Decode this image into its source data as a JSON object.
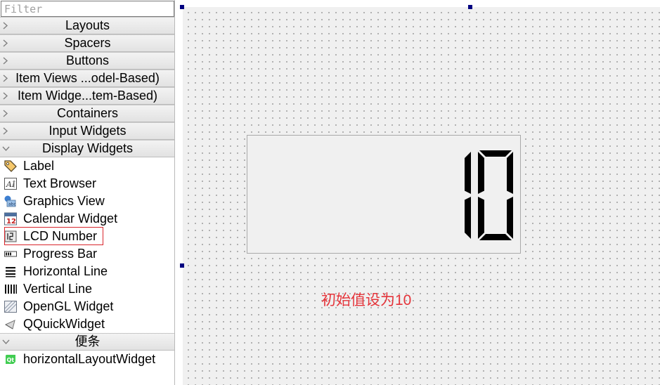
{
  "widget_box": {
    "filter_placeholder": "Filter",
    "categories": [
      {
        "label": "Layouts",
        "expanded": false
      },
      {
        "label": "Spacers",
        "expanded": false
      },
      {
        "label": "Buttons",
        "expanded": false
      },
      {
        "label": "Item Views ...odel-Based)",
        "expanded": false
      },
      {
        "label": "Item Widge...tem-Based)",
        "expanded": false
      },
      {
        "label": "Containers",
        "expanded": false
      },
      {
        "label": "Input Widgets",
        "expanded": false
      },
      {
        "label": "Display Widgets",
        "expanded": true
      },
      {
        "label": "便条",
        "expanded": true
      }
    ],
    "display_widgets": [
      {
        "label": "Label",
        "icon": "label-tag-icon"
      },
      {
        "label": "Text Browser",
        "icon": "text-browser-icon"
      },
      {
        "label": "Graphics View",
        "icon": "graphics-view-icon"
      },
      {
        "label": "Calendar Widget",
        "icon": "calendar-icon"
      },
      {
        "label": "LCD Number",
        "icon": "lcd-number-icon"
      },
      {
        "label": "Progress Bar",
        "icon": "progress-bar-icon"
      },
      {
        "label": "Horizontal Line",
        "icon": "horizontal-line-icon"
      },
      {
        "label": "Vertical Line",
        "icon": "vertical-line-icon"
      },
      {
        "label": "OpenGL Widget",
        "icon": "opengl-icon"
      },
      {
        "label": "QQuickWidget",
        "icon": "qquick-icon"
      }
    ],
    "scratchpad_items": [
      {
        "label": "horizontalLayoutWidget",
        "icon": "qt-logo-icon"
      }
    ],
    "calendar_icon_text": "12",
    "qt_icon_text": "Qt",
    "highlight_color": "#d9262c"
  },
  "form": {
    "lcd_value": "10",
    "annotation": "初始值设为10",
    "annotation_color": "#e4343a",
    "selection_handle_color": "#000080"
  }
}
